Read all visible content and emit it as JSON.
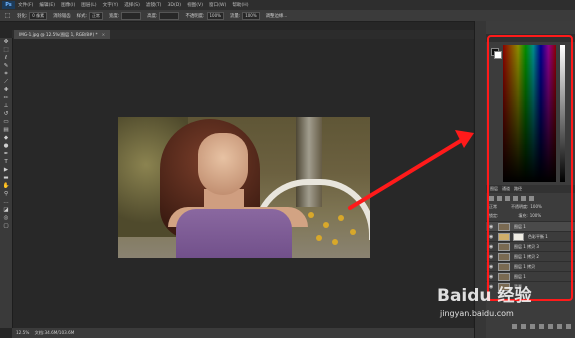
{
  "menubar": {
    "logo": "Ps",
    "items": [
      "文件(F)",
      "编辑(E)",
      "图像(I)",
      "图层(L)",
      "文字(Y)",
      "选择(S)",
      "滤镜(T)",
      "3D(D)",
      "视图(V)",
      "窗口(W)",
      "帮助(H)"
    ]
  },
  "options": {
    "feather_label": "羽化:",
    "feather_value": "0 像素",
    "antialias_label": "消除锯齿",
    "style_label": "样式:",
    "style_value": "正常",
    "width_label": "宽度:",
    "height_label": "高度:",
    "adjust_label": "调整边缘...",
    "opacity_label": "不透明度:",
    "opacity_value": "100%",
    "flow_label": "流量:",
    "flow_value": "100%"
  },
  "document": {
    "tab_label": "IMG-1.jpg @ 12.5%(图层 1, RGB/8#) *",
    "tab_close": "×"
  },
  "status": {
    "zoom": "12.5%",
    "doc_size": "文档:34.6M/103.6M"
  },
  "layers_panel": {
    "tabs": [
      "图层",
      "通道",
      "路径"
    ],
    "blend_mode": "正常",
    "opacity_label": "不透明度:",
    "opacity_value": "100%",
    "lock_label": "锁定:",
    "fill_label": "填充:",
    "fill_value": "100%",
    "layers": [
      {
        "name": "图层 1",
        "mask": false
      },
      {
        "name": "色彩平衡 1",
        "mask": true
      },
      {
        "name": "图层 1 拷贝 3",
        "mask": false
      },
      {
        "name": "图层 1 拷贝 2",
        "mask": false
      },
      {
        "name": "图层 1 拷贝",
        "mask": false
      },
      {
        "name": "图层 1",
        "mask": false
      },
      {
        "name": "背景",
        "mask": false
      }
    ]
  },
  "watermark": {
    "brand": "Baidu 经验",
    "url": "jingyan.baidu.com"
  },
  "colors": {
    "highlight": "#ff1a1a",
    "panel_bg": "#3c3c3c",
    "canvas_bg": "#282828"
  }
}
